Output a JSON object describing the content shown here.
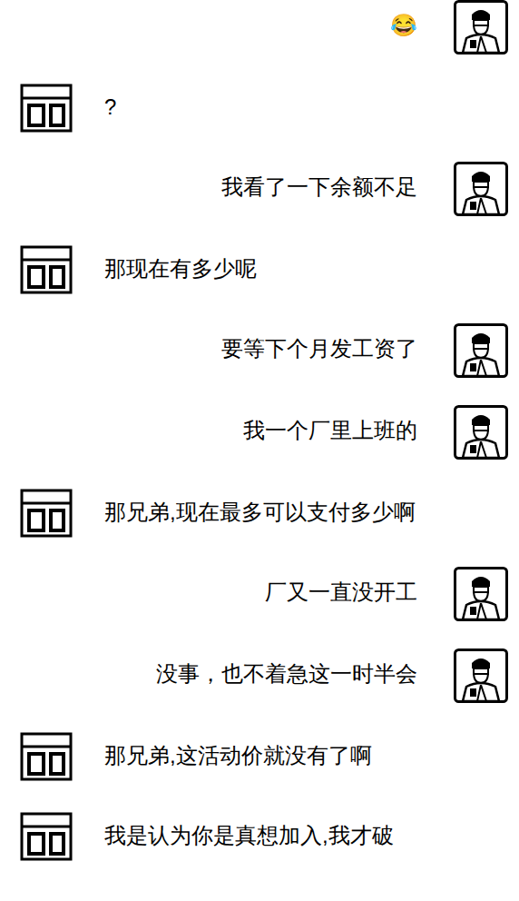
{
  "messages": [
    {
      "kind": "sent",
      "text": "😂"
    },
    {
      "kind": "received",
      "text": "?"
    },
    {
      "kind": "sent",
      "text": "我看了一下余额不足"
    },
    {
      "kind": "received",
      "text": "那现在有多少呢"
    },
    {
      "kind": "sent",
      "text": "要等下个月发工资了"
    },
    {
      "kind": "sent",
      "text": "我一个厂里上班的"
    },
    {
      "kind": "received",
      "text": "那兄弟,现在最多可以支付多少啊"
    },
    {
      "kind": "sent",
      "text": "厂又一直没开工"
    },
    {
      "kind": "sent",
      "text": "没事，也不着急这一时半会"
    },
    {
      "kind": "received",
      "text": "那兄弟,这活动价就没有了啊"
    },
    {
      "kind": "received",
      "text": "我是认为你是真想加入,我才破"
    }
  ]
}
